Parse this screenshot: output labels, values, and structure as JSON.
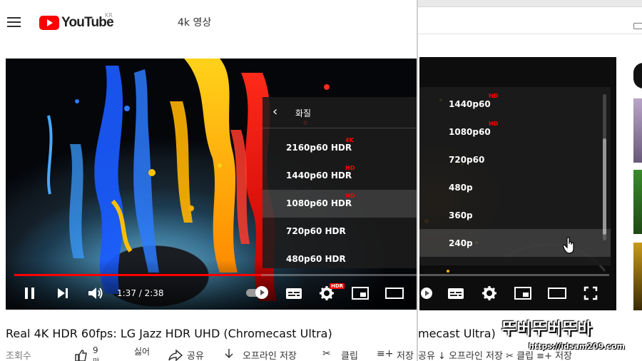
{
  "masthead": {
    "logo_text": "YouTube",
    "country": "KR",
    "search_query": "4k 영상"
  },
  "quality_menu": {
    "title": "화질",
    "options": [
      {
        "label": "2160p60 HDR",
        "badge": "4K",
        "selected": false
      },
      {
        "label": "1440p60 HDR",
        "badge": "HD",
        "selected": false
      },
      {
        "label": "1080p60 HDR",
        "badge": "HD",
        "selected": true
      },
      {
        "label": "720p60 HDR",
        "badge": "",
        "selected": false
      },
      {
        "label": "480p60 HDR",
        "badge": "",
        "selected": false
      }
    ]
  },
  "player": {
    "time": "1:37 / 2:38",
    "progress": 0.61,
    "settings_badge": "HDR"
  },
  "video": {
    "title": "Real 4K HDR 60fps: LG Jazz HDR UHD (Chromecast Ultra)"
  },
  "actions": {
    "views": "조회수",
    "like_count": "9",
    "like_suffix": "만",
    "dislike": "싫어",
    "share": "공유",
    "download": "오프라인 저장",
    "clip": "클립",
    "save": "저장"
  },
  "quality_menu_2": {
    "options": [
      {
        "label": "1440p60",
        "badge": "HD",
        "hover": false
      },
      {
        "label": "1080p60",
        "badge": "HD",
        "hover": false
      },
      {
        "label": "720p60",
        "badge": "",
        "hover": false
      },
      {
        "label": "480p",
        "badge": "",
        "hover": false
      },
      {
        "label": "360p",
        "badge": "",
        "hover": false
      },
      {
        "label": "240p",
        "badge": "",
        "hover": true
      }
    ]
  },
  "second_window": {
    "title_fragment": "mecast Ultra)",
    "actions_fragment": "공유   ↓ 오프라인 저장   ✂ 클립   ≡+ 저장"
  },
  "watermark": {
    "big": "뚜버뚜버뚜바",
    "small": "https://idsam209.com"
  },
  "colors": {
    "youtube_red": "#ff0000",
    "badge_red": "#ff0000",
    "menu_bg": "#1c1c1c"
  }
}
